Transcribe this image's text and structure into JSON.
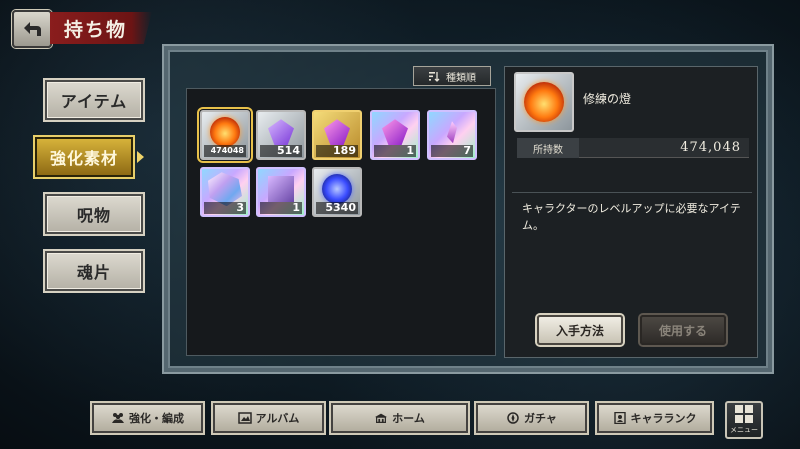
{
  "header": {
    "title": "持ち物"
  },
  "tabs": [
    {
      "label": "アイテム",
      "active": false
    },
    {
      "label": "強化素材",
      "active": true
    },
    {
      "label": "呪物",
      "active": false
    },
    {
      "label": "魂片",
      "active": false
    }
  ],
  "sort": {
    "label": "種類順"
  },
  "items": [
    {
      "count": "474048",
      "kind": "orange-orb",
      "selected": true
    },
    {
      "count": "514",
      "kind": "purple-crystal-small"
    },
    {
      "count": "189",
      "kind": "purple-crystal-gold"
    },
    {
      "count": "1",
      "kind": "purple-crystal-rainbow"
    },
    {
      "count": "7",
      "kind": "pink-shard"
    },
    {
      "count": "3",
      "kind": "rainbow-crystal"
    },
    {
      "count": "1",
      "kind": "crystal-cube"
    },
    {
      "count": "5340",
      "kind": "blue-orb"
    }
  ],
  "detail": {
    "name": "修練の燈",
    "qty_label": "所持数",
    "qty_value": "474,048",
    "description": "キャラクターのレベルアップに必要なアイテム。",
    "acquire_label": "入手方法",
    "use_label": "使用する"
  },
  "nav": {
    "enhance": "強化・編成",
    "album": "アルバム",
    "home": "ホーム",
    "gacha": "ガチャ",
    "rank": "キャラランク",
    "menu": "メニュー"
  },
  "colors": {
    "accent_gold": "#d6b23a",
    "banner_red": "#8a1d1d"
  }
}
